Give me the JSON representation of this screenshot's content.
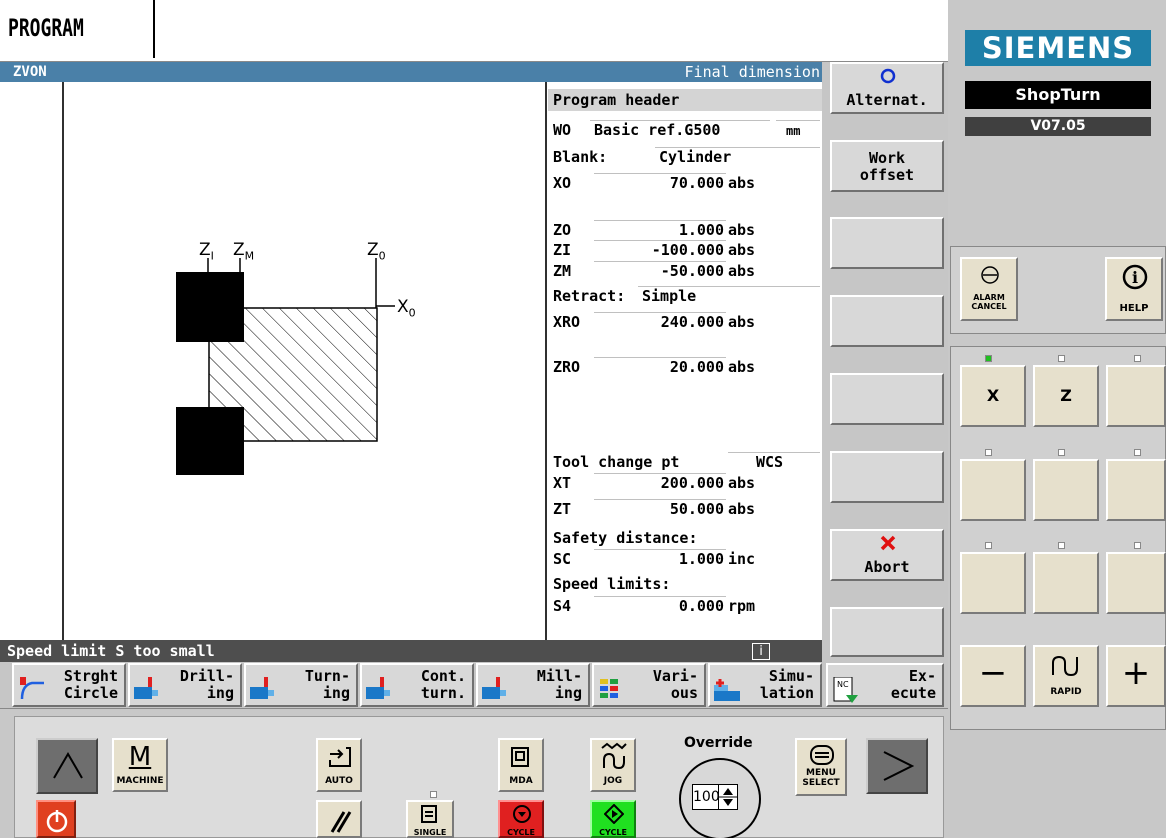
{
  "window": {
    "area_title": "PROGRAM",
    "program_name": "ZVON",
    "mode_title": "Final dimension"
  },
  "form": {
    "section_title": "Program header",
    "wo_label": "WO",
    "wo_value": "Basic ref.G500",
    "unit": "mm",
    "blank_label": "Blank:",
    "blank_value": "Cylinder",
    "rows": [
      {
        "label": "XO",
        "value": "70.000",
        "unit": "abs"
      },
      {
        "label": "ZO",
        "value": "1.000",
        "unit": "abs"
      },
      {
        "label": "ZI",
        "value": "-100.000",
        "unit": "abs"
      },
      {
        "label": "ZM",
        "value": "-50.000",
        "unit": "abs"
      },
      {
        "label": "XRO",
        "value": "240.000",
        "unit": "abs"
      },
      {
        "label": "ZRO",
        "value": "20.000",
        "unit": "abs"
      },
      {
        "label": "XT",
        "value": "200.000",
        "unit": "abs"
      },
      {
        "label": "ZT",
        "value": "50.000",
        "unit": "abs"
      },
      {
        "label": "SC",
        "value": "1.000",
        "unit": "inc"
      },
      {
        "label": "S4",
        "value": "0.000",
        "unit": "rpm"
      }
    ],
    "retract_label": "Retract:",
    "retract_value": "Simple",
    "tool_change_label": "Tool change pt",
    "tool_change_value": "WCS",
    "safety_label": "Safety distance:",
    "speed_label": "Speed limits:"
  },
  "diagram": {
    "zi": "Z",
    "zi_sub": "I",
    "zm": "Z",
    "zm_sub": "M",
    "zo": "Z",
    "zo_sub": "0",
    "xo": "X",
    "xo_sub": "0"
  },
  "status": {
    "message": "Speed limit S too small",
    "info": "i"
  },
  "vertical_softkeys": {
    "alternat": "Alternat.",
    "work1": "Work",
    "work2": "offset",
    "abort": "Abort"
  },
  "horizontal_softkeys": [
    {
      "l1": "Strght",
      "l2": "Circle"
    },
    {
      "l1": "Drill-",
      "l2": "ing"
    },
    {
      "l1": "Turn-",
      "l2": "ing"
    },
    {
      "l1": "Cont.",
      "l2": "turn."
    },
    {
      "l1": "Mill-",
      "l2": "ing"
    },
    {
      "l1": "Vari-",
      "l2": "ous"
    },
    {
      "l1": "Simu-",
      "l2": "lation"
    },
    {
      "l1": "Ex-",
      "l2": "ecute"
    }
  ],
  "right_panel": {
    "brand": "SIEMENS",
    "product": "ShopTurn",
    "version": "V07.05",
    "alarm_cancel1": "ALARM",
    "alarm_cancel2": "CANCEL",
    "help": "HELP",
    "axis_x": "X",
    "axis_z": "Z",
    "minus": "−",
    "plus": "+",
    "rapid": "RAPID"
  },
  "bottom_panel": {
    "machine": "MACHINE",
    "auto": "AUTO",
    "mda": "MDA",
    "jog": "JOG",
    "override": "Override",
    "override_value": "100",
    "menu1": "MENU",
    "menu2": "SELECT",
    "single": "SINGLE",
    "cycle_stop": "CYCLE",
    "cycle_start": "CYCLE"
  }
}
